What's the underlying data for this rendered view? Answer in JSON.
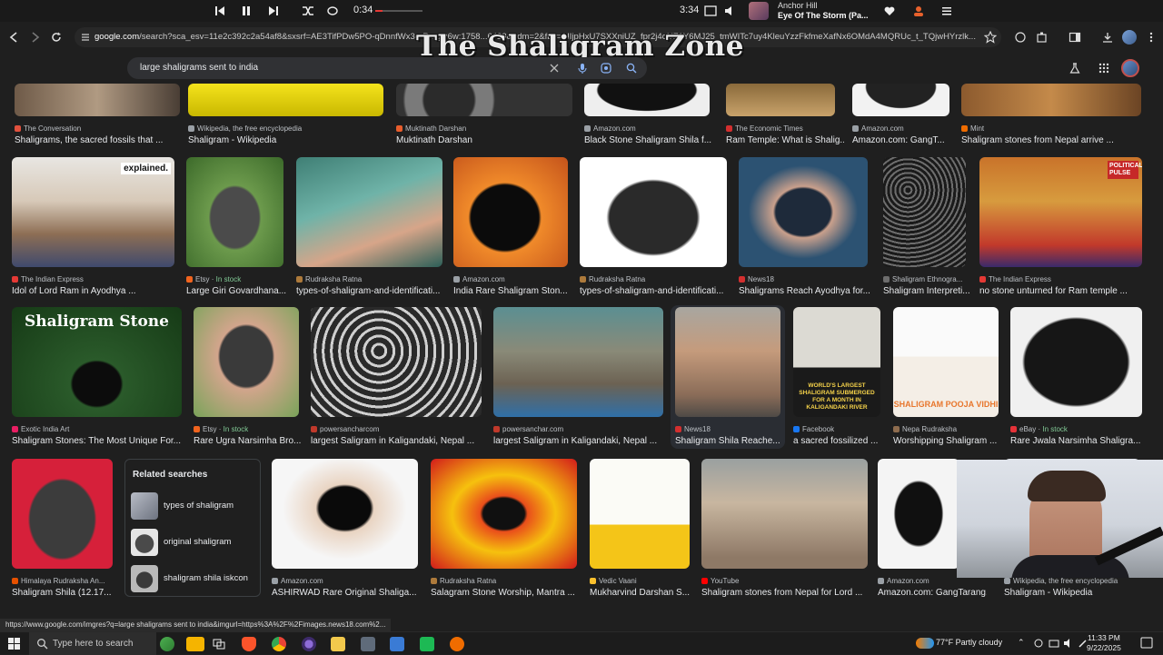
{
  "media": {
    "current_time": "0:34",
    "duration": "3:34",
    "progress": 0.16,
    "artist": "Anchor Hill",
    "track": "Eye Of The Storm (Pa..."
  },
  "browser": {
    "url_host": "google.com",
    "url_rest": "/search?sca_esv=11e2c392c2a54af8&sxsrf=AE3TifPDw5PO-qDnnfWx3e-R...gQ6w:1758...6423&udm=2&fbs=AIIjpHxU7SXXniUZ_fpr2j4qUZ1Y6MJ25_tmWITc7uy4KleuYzzFkfmeXafNx6OMdA4MQRUc_t_TQjwHYrzlk...",
    "watermark": "The Shaligram Zone"
  },
  "search": {
    "query": "large shaligrams sent to india"
  },
  "rows": {
    "row0": [
      {
        "source": "The Conversation",
        "caption": "Shaligrams, the sacred fossils that ..."
      },
      {
        "source": "Wikipedia, the free encyclopedia",
        "caption": "Shaligram - Wikipedia"
      },
      {
        "source": "Muktinath Darshan",
        "caption": "Muktinath Darshan"
      },
      {
        "source": "Amazon.com",
        "caption": "Black Stone Shaligram Shila f..."
      },
      {
        "source": "The Economic Times",
        "caption": "Ram Temple: What is Shalig..."
      },
      {
        "source": "Amazon.com",
        "caption": "Amazon.com: GangT..."
      },
      {
        "source": "Mint",
        "caption": "Shaligram stones from Nepal arrive ..."
      }
    ],
    "row1": [
      {
        "source": "The Indian Express",
        "caption": "Idol of Lord Ram in Ayodhya ...",
        "overlay": "explained."
      },
      {
        "source": "Etsy",
        "stock": "In stock",
        "caption": "Large Giri Govardhana..."
      },
      {
        "source": "Rudraksha Ratna",
        "caption": "types-of-shaligram-and-identificati..."
      },
      {
        "source": "Amazon.com",
        "caption": "India Rare Shaligram Ston..."
      },
      {
        "source": "Rudraksha Ratna",
        "caption": "types-of-shaligram-and-identificati..."
      },
      {
        "source": "News18",
        "caption": "Shaligrams Reach Ayodhya for..."
      },
      {
        "source": "Shaligram Ethnogra...",
        "caption": "Shaligram Interpreti..."
      },
      {
        "source": "The Indian Express",
        "caption": "no stone unturned for Ram temple ...",
        "overlay": "POLITICAL PULSE"
      }
    ],
    "row2": [
      {
        "source": "Exotic India Art",
        "caption": "Shaligram Stones: The Most Unique For...",
        "overlay": "Shaligram Stone"
      },
      {
        "source": "Etsy",
        "stock": "In stock",
        "caption": "Rare Ugra Narsimha Bro..."
      },
      {
        "source": "powersancharcom",
        "caption": "largest Saligram in Kaligandaki, Nepal ..."
      },
      {
        "source": "powersanchar.com",
        "caption": "largest Saligram in Kaligandaki, Nepal ..."
      },
      {
        "source": "News18",
        "caption": "Shaligram Shila Reache..."
      },
      {
        "source": "Facebook",
        "caption": "a sacred fossilized ...",
        "overlay": "WORLD'S LARGEST SHALIGRAM SUBMERGED FOR A MONTH IN KALIGANDAKI RIVER"
      },
      {
        "source": "Nepa Rudraksha",
        "caption": "Worshipping Shaligram ...",
        "overlay": "SHALIGRAM POOJA VIDHI"
      },
      {
        "source": "eBay",
        "stock": "In stock",
        "caption": "Rare Jwala Narsimha Shaligra..."
      }
    ],
    "row3": [
      {
        "source": "Himalaya Rudraksha An...",
        "caption": "Shaligram Shila (12.17..."
      },
      {
        "source": "Amazon.com",
        "caption": "ASHIRWAD Rare Original Shaliga..."
      },
      {
        "source": "Rudraksha Ratna",
        "caption": "Salagram Stone Worship, Mantra ..."
      },
      {
        "source": "Vedic Vaani",
        "caption": "Mukharvind Darshan S..."
      },
      {
        "source": "YouTube",
        "caption": "Shaligram stones from Nepal for Lord ..."
      },
      {
        "source": "Amazon.com",
        "caption": "Amazon.com: GangTarang..."
      },
      {
        "source": "Wikipedia, the free encyclopedia",
        "caption": "Shaligram - Wikipedia"
      }
    ]
  },
  "related": {
    "title": "Related searches",
    "items": [
      "types of shaligram",
      "original shaligram",
      "shaligram shila iskcon"
    ]
  },
  "status_url": "https://www.google.com/imgres?q=large shaligrams sent to india&imgurl=https%3A%2F%2Fimages.news18.com%2...",
  "taskbar": {
    "search_placeholder": "Type here to search",
    "weather": "77°F  Partly cloudy",
    "time": "11:33 PM",
    "date": "9/22/2025"
  },
  "colors": {
    "accent": "#e53935",
    "link_green": "#81c995",
    "page_bg": "#1f1f1f"
  }
}
